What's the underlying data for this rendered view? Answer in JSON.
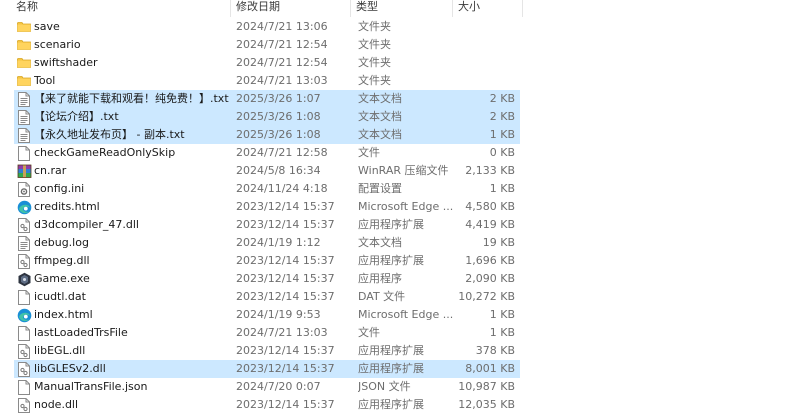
{
  "header": {
    "name_label": "名称",
    "date_label": "修改日期",
    "type_label": "类型",
    "size_label": "大小"
  },
  "colors": {
    "selection": "#cce8ff",
    "folder": "#f5c542",
    "edge": "#1a8fd6"
  },
  "files": [
    {
      "name": "save",
      "date": "2024/7/21 13:06",
      "type": "文件夹",
      "size": "",
      "icon": "folder-icon",
      "selected": false
    },
    {
      "name": "scenario",
      "date": "2024/7/21 12:54",
      "type": "文件夹",
      "size": "",
      "icon": "folder-icon",
      "selected": false
    },
    {
      "name": "swiftshader",
      "date": "2024/7/21 12:54",
      "type": "文件夹",
      "size": "",
      "icon": "folder-icon",
      "selected": false
    },
    {
      "name": "Tool",
      "date": "2024/7/21 13:03",
      "type": "文件夹",
      "size": "",
      "icon": "folder-icon",
      "selected": false
    },
    {
      "name": "【来了就能下载和观看！纯免费！】.txt",
      "date": "2025/3/26 1:07",
      "type": "文本文档",
      "size": "2 KB",
      "icon": "text-file-icon",
      "selected": true
    },
    {
      "name": "【论坛介绍】.txt",
      "date": "2025/3/26 1:08",
      "type": "文本文档",
      "size": "2 KB",
      "icon": "text-file-icon",
      "selected": true
    },
    {
      "name": "【永久地址发布页】 - 副本.txt",
      "date": "2025/3/26 1:08",
      "type": "文本文档",
      "size": "1 KB",
      "icon": "text-file-icon",
      "selected": true
    },
    {
      "name": "checkGameReadOnlySkip",
      "date": "2024/7/21 12:58",
      "type": "文件",
      "size": "0 KB",
      "icon": "blank-file-icon",
      "selected": false
    },
    {
      "name": "cn.rar",
      "date": "2024/5/8 16:34",
      "type": "WinRAR 压缩文件",
      "size": "2,133 KB",
      "icon": "winrar-icon",
      "selected": false
    },
    {
      "name": "config.ini",
      "date": "2024/11/24 4:18",
      "type": "配置设置",
      "size": "1 KB",
      "icon": "config-file-icon",
      "selected": false
    },
    {
      "name": "credits.html",
      "date": "2023/12/14 15:37",
      "type": "Microsoft Edge ...",
      "size": "4,580 KB",
      "icon": "edge-icon",
      "selected": false
    },
    {
      "name": "d3dcompiler_47.dll",
      "date": "2023/12/14 15:37",
      "type": "应用程序扩展",
      "size": "4,419 KB",
      "icon": "dll-file-icon",
      "selected": false
    },
    {
      "name": "debug.log",
      "date": "2024/1/19 1:12",
      "type": "文本文档",
      "size": "19 KB",
      "icon": "text-file-icon",
      "selected": false
    },
    {
      "name": "ffmpeg.dll",
      "date": "2023/12/14 15:37",
      "type": "应用程序扩展",
      "size": "1,696 KB",
      "icon": "dll-file-icon",
      "selected": false
    },
    {
      "name": "Game.exe",
      "date": "2023/12/14 15:37",
      "type": "应用程序",
      "size": "2,090 KB",
      "icon": "game-exe-icon",
      "selected": false
    },
    {
      "name": "icudtl.dat",
      "date": "2023/12/14 15:37",
      "type": "DAT 文件",
      "size": "10,272 KB",
      "icon": "blank-file-icon",
      "selected": false
    },
    {
      "name": "index.html",
      "date": "2024/1/19 9:53",
      "type": "Microsoft Edge ...",
      "size": "1 KB",
      "icon": "edge-icon",
      "selected": false
    },
    {
      "name": "lastLoadedTrsFile",
      "date": "2024/7/21 13:03",
      "type": "文件",
      "size": "1 KB",
      "icon": "blank-file-icon",
      "selected": false
    },
    {
      "name": "libEGL.dll",
      "date": "2023/12/14 15:37",
      "type": "应用程序扩展",
      "size": "378 KB",
      "icon": "dll-file-icon",
      "selected": false
    },
    {
      "name": "libGLESv2.dll",
      "date": "2023/12/14 15:37",
      "type": "应用程序扩展",
      "size": "8,001 KB",
      "icon": "dll-file-icon",
      "selected": true
    },
    {
      "name": "ManualTransFile.json",
      "date": "2024/7/20 0:07",
      "type": "JSON 文件",
      "size": "10,987 KB",
      "icon": "blank-file-icon",
      "selected": false
    },
    {
      "name": "node.dll",
      "date": "2023/12/14 15:37",
      "type": "应用程序扩展",
      "size": "12,035 KB",
      "icon": "dll-file-icon",
      "selected": false
    }
  ]
}
